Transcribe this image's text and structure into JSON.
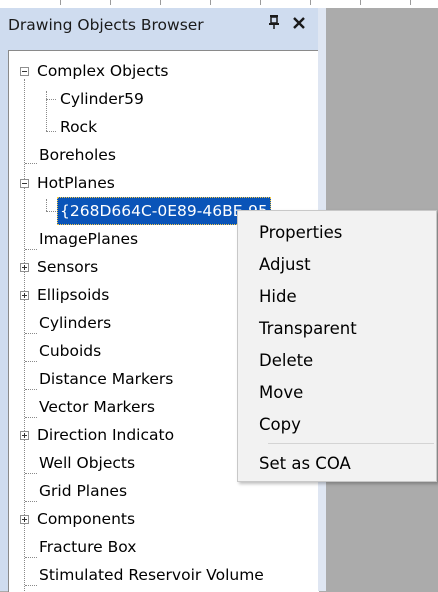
{
  "panel": {
    "title": "Drawing Objects Browser",
    "pin_glyph": "p",
    "close_glyph": "✕"
  },
  "tree": {
    "complex_objects": "Complex Objects",
    "cylinder59": "Cylinder59",
    "rock": "Rock",
    "boreholes": "Boreholes",
    "hotplanes": "HotPlanes",
    "hotplane_guid": "{268D664C-0E89-46BE-95",
    "imageplanes": "ImagePlanes",
    "sensors": "Sensors",
    "ellipsoids": "Ellipsoids",
    "cylinders": "Cylinders",
    "cuboids": "Cuboids",
    "distance_markers": "Distance Markers",
    "vector_markers": "Vector Markers",
    "direction_indicators": "Direction Indicato",
    "well_objects": "Well Objects",
    "grid_planes": "Grid Planes",
    "components": "Components",
    "fracture_box": "Fracture Box",
    "stimulated_reservoir_volume": "Stimulated Reservoir Volume"
  },
  "context_menu": {
    "properties": "Properties",
    "adjust": "Adjust",
    "hide": "Hide",
    "transparent": "Transparent",
    "delete": "Delete",
    "move": "Move",
    "copy": "Copy",
    "set_as_coa": "Set as COA"
  },
  "colors": {
    "selection": "#0a54b8",
    "panel_bg": "#cfdcef",
    "workspace_bg": "#ababab"
  }
}
